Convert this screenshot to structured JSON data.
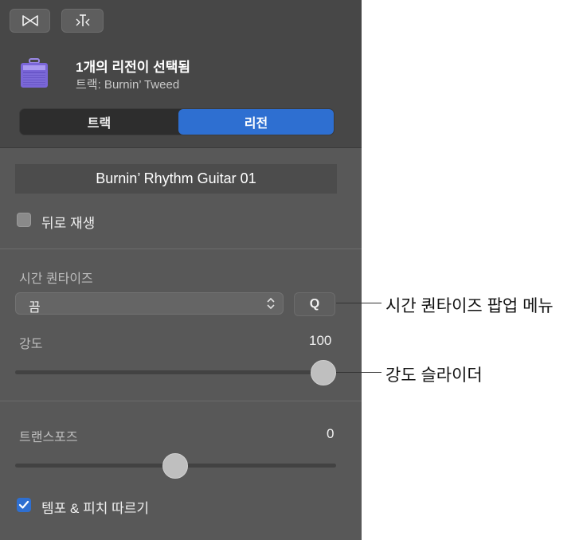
{
  "toolbar": {
    "left_icon": "bowtie-icon",
    "right_icon": "branch-icon"
  },
  "header": {
    "title": "1개의 리전이 선택됨",
    "subtitle": "트랙: Burnin’ Tweed",
    "icon": "amp-icon"
  },
  "segmented": {
    "track_label": "트랙",
    "region_label": "리전",
    "selected": "리전"
  },
  "region": {
    "name": "Burnin’ Rhythm Guitar 01",
    "reverse_label": "뒤로 재생",
    "reverse_checked": false
  },
  "time_quantize": {
    "label": "시간 퀀타이즈",
    "value": "끔",
    "q_button": "Q"
  },
  "strength": {
    "label": "강도",
    "value": "100",
    "level": 1.0
  },
  "transpose": {
    "label": "트랜스포즈",
    "value": "0",
    "level": 0.5
  },
  "follow": {
    "label": "템포 & 피치 따르기",
    "checked": true
  },
  "callouts": {
    "quantize_popup": "시간 퀀타이즈 팝업 메뉴",
    "strength_slider": "강도 슬라이더"
  },
  "colors": {
    "accent": "#2e6fd1",
    "panel": "#585858",
    "header": "#474747"
  }
}
